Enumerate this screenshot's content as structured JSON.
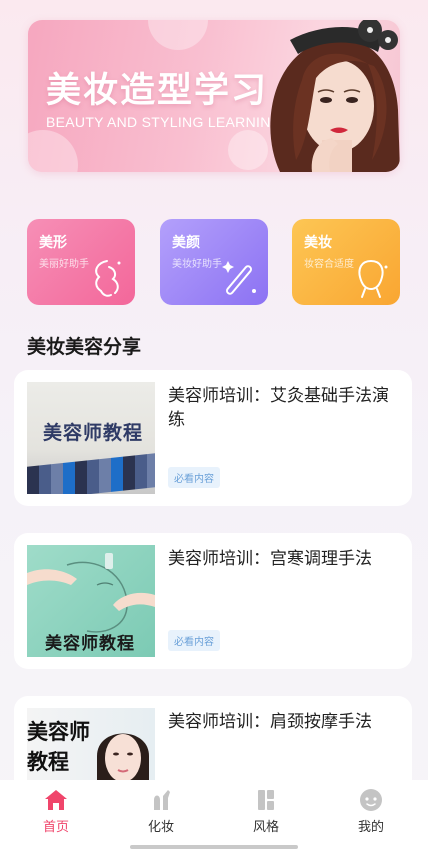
{
  "banner": {
    "title": "美妆造型学习",
    "subtitle": "BEAUTY AND STYLING LEARNING"
  },
  "categories": [
    {
      "title": "美形",
      "subtitle": "美丽好助手",
      "icon": "body-silhouette-icon"
    },
    {
      "title": "美颜",
      "subtitle": "美妆好助手",
      "icon": "magic-wand-icon"
    },
    {
      "title": "美妆",
      "subtitle": "妆容合适度",
      "icon": "face-outline-icon"
    }
  ],
  "section": {
    "title": "美妆美容分享"
  },
  "articles": [
    {
      "title": "美容师培训：艾灸基础手法演练",
      "tag": "必看内容",
      "thumb_text": "美容师教程"
    },
    {
      "title": "美容师培训：宫寒调理手法",
      "tag": "必看内容",
      "thumb_text": "美容师教程"
    },
    {
      "title": "美容师培训：肩颈按摩手法",
      "thumb_text_line1": "美容师",
      "thumb_text_line2": "教程"
    }
  ],
  "nav": {
    "items": [
      {
        "label": "首页",
        "icon": "home-icon",
        "active": true
      },
      {
        "label": "化妆",
        "icon": "makeup-icon",
        "active": false
      },
      {
        "label": "风格",
        "icon": "style-icon",
        "active": false
      },
      {
        "label": "我的",
        "icon": "profile-icon",
        "active": false
      }
    ]
  },
  "colors": {
    "accent": "#f0456b",
    "card_pink": "#f3679a",
    "card_purple": "#8c72f3",
    "card_orange": "#f9a632",
    "tag_text": "#6aa0d8"
  }
}
